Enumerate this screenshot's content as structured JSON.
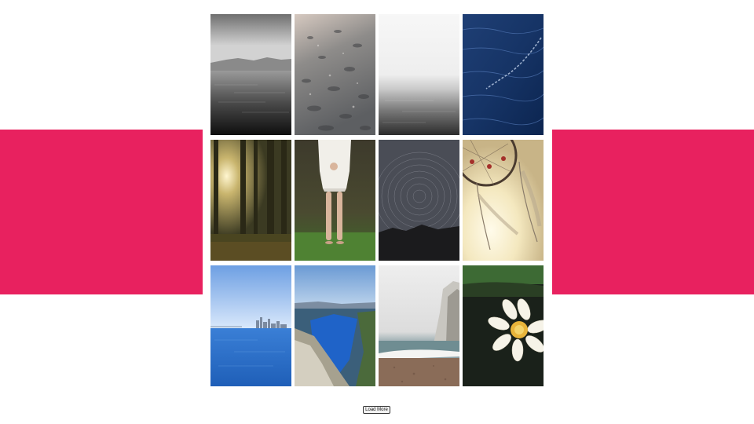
{
  "colors": {
    "accent_band": "#e8215f",
    "background": "#ffffff"
  },
  "gallery": {
    "photos": [
      {
        "subject": "misty-sea-grayscale"
      },
      {
        "subject": "wet-pebbles"
      },
      {
        "subject": "foggy-horizon-sea"
      },
      {
        "subject": "deep-blue-water"
      },
      {
        "subject": "sunlit-forest"
      },
      {
        "subject": "woman-white-dress-grass"
      },
      {
        "subject": "star-trails-night"
      },
      {
        "subject": "dreamcatcher"
      },
      {
        "subject": "city-skyline-bay"
      },
      {
        "subject": "fjord-cliffs"
      },
      {
        "subject": "foggy-coast-beach"
      },
      {
        "subject": "water-lily"
      }
    ]
  },
  "actions": {
    "load_more_label": "Load More"
  }
}
